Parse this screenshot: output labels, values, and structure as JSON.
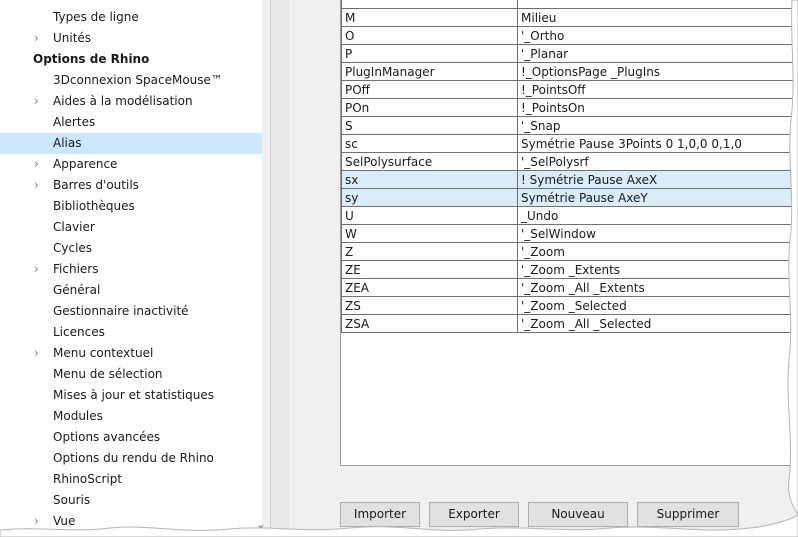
{
  "tree": {
    "items": [
      {
        "label": "Types de ligne",
        "chevron": ""
      },
      {
        "label": "Unités",
        "chevron": "›"
      },
      {
        "label": "Options de Rhino",
        "chevron": "",
        "root": true
      },
      {
        "label": "3Dconnexion SpaceMouse™",
        "chevron": ""
      },
      {
        "label": "Aides à la modélisation",
        "chevron": "›"
      },
      {
        "label": "Alertes",
        "chevron": ""
      },
      {
        "label": "Alias",
        "chevron": "",
        "selected": true
      },
      {
        "label": "Apparence",
        "chevron": "›"
      },
      {
        "label": "Barres d'outils",
        "chevron": "›"
      },
      {
        "label": "Bibliothèques",
        "chevron": ""
      },
      {
        "label": "Clavier",
        "chevron": ""
      },
      {
        "label": "Cycles",
        "chevron": ""
      },
      {
        "label": "Fichiers",
        "chevron": "›"
      },
      {
        "label": "Général",
        "chevron": ""
      },
      {
        "label": "Gestionnaire inactivité",
        "chevron": ""
      },
      {
        "label": "Licences",
        "chevron": ""
      },
      {
        "label": "Menu contextuel",
        "chevron": "›"
      },
      {
        "label": "Menu de sélection",
        "chevron": ""
      },
      {
        "label": "Mises à jour et statistiques",
        "chevron": ""
      },
      {
        "label": "Modules",
        "chevron": ""
      },
      {
        "label": "Options avancées",
        "chevron": ""
      },
      {
        "label": "Options du rendu de Rhino",
        "chevron": ""
      },
      {
        "label": "RhinoScript",
        "chevron": ""
      },
      {
        "label": "Souris",
        "chevron": ""
      },
      {
        "label": "Vue",
        "chevron": "›"
      }
    ],
    "scroll_down_glyph": "⌄"
  },
  "aliases": {
    "rows": [
      {
        "alias": "M",
        "macro": "Milieu"
      },
      {
        "alias": "O",
        "macro": "'_Ortho"
      },
      {
        "alias": "P",
        "macro": "'_Planar"
      },
      {
        "alias": "PlugInManager",
        "macro": "!_OptionsPage _PlugIns"
      },
      {
        "alias": "POff",
        "macro": "!_PointsOff"
      },
      {
        "alias": "POn",
        "macro": "!_PointsOn"
      },
      {
        "alias": "S",
        "macro": "'_Snap"
      },
      {
        "alias": "sc",
        "macro": "Symétrie Pause 3Points 0 1,0,0 0,1,0"
      },
      {
        "alias": "SelPolysurface",
        "macro": "'_SelPolysrf"
      },
      {
        "alias": "sx",
        "macro": "! Symétrie Pause AxeX",
        "selected": true
      },
      {
        "alias": "sy",
        "macro": "Symétrie Pause AxeY",
        "selected": true
      },
      {
        "alias": "U",
        "macro": "_Undo"
      },
      {
        "alias": "W",
        "macro": "'_SelWindow"
      },
      {
        "alias": "Z",
        "macro": "'_Zoom"
      },
      {
        "alias": "ZE",
        "macro": "'_Zoom _Extents"
      },
      {
        "alias": "ZEA",
        "macro": "'_Zoom _All _Extents"
      },
      {
        "alias": "ZS",
        "macro": "'_Zoom _Selected"
      },
      {
        "alias": "ZSA",
        "macro": "'_Zoom _All _Selected"
      }
    ]
  },
  "buttons": {
    "import": "Importer",
    "export": "Exporter",
    "new": "Nouveau",
    "delete": "Supprimer"
  }
}
